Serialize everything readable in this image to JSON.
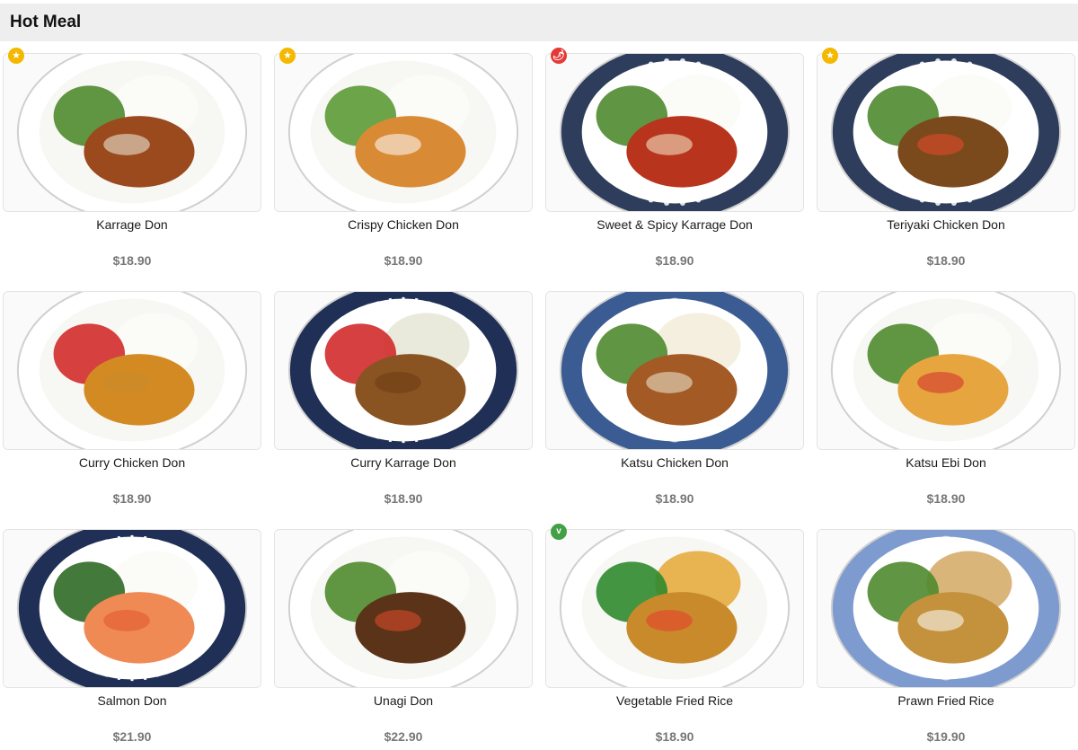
{
  "section": {
    "title": "Hot Meal"
  },
  "colors": {
    "star_badge": "#f5b800",
    "spicy_badge": "#e53935",
    "veg_badge": "#43a047",
    "price_text": "#777777",
    "header_bg": "#eeeeee"
  },
  "items": [
    {
      "name": "Karrage Don",
      "price": "$18.90",
      "badge": "star",
      "badge_glyph": "★",
      "icon": "karrage-don-photo"
    },
    {
      "name": "Crispy Chicken Don",
      "price": "$18.90",
      "badge": "star",
      "badge_glyph": "★",
      "icon": "crispy-chicken-don-photo"
    },
    {
      "name": "Sweet & Spicy Karrage Don",
      "price": "$18.90",
      "badge": "spicy",
      "badge_glyph": "🌶",
      "icon": "sweet-spicy-karrage-don-photo"
    },
    {
      "name": "Teriyaki Chicken Don",
      "price": "$18.90",
      "badge": "star",
      "badge_glyph": "★",
      "icon": "teriyaki-chicken-don-photo"
    },
    {
      "name": "Curry Chicken Don",
      "price": "$18.90",
      "badge": "",
      "badge_glyph": "",
      "icon": "curry-chicken-don-photo"
    },
    {
      "name": "Curry Karrage Don",
      "price": "$18.90",
      "badge": "",
      "badge_glyph": "",
      "icon": "curry-karrage-don-photo"
    },
    {
      "name": "Katsu Chicken Don",
      "price": "$18.90",
      "badge": "",
      "badge_glyph": "",
      "icon": "katsu-chicken-don-photo"
    },
    {
      "name": "Katsu Ebi Don",
      "price": "$18.90",
      "badge": "",
      "badge_glyph": "",
      "icon": "katsu-ebi-don-photo"
    },
    {
      "name": "Salmon Don",
      "price": "$21.90",
      "badge": "",
      "badge_glyph": "",
      "icon": "salmon-don-photo"
    },
    {
      "name": "Unagi Don",
      "price": "$22.90",
      "badge": "",
      "badge_glyph": "",
      "icon": "unagi-don-photo"
    },
    {
      "name": "Vegetable Fried Rice",
      "price": "$18.90",
      "badge": "veg",
      "badge_glyph": "v",
      "icon": "vegetable-fried-rice-photo"
    },
    {
      "name": "Prawn Fried Rice",
      "price": "$19.90",
      "badge": "",
      "badge_glyph": "",
      "icon": "prawn-fried-rice-photo"
    }
  ]
}
